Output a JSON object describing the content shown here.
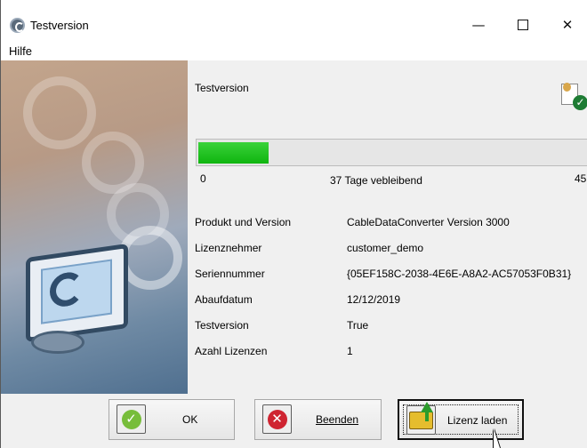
{
  "window": {
    "title": "Testversion"
  },
  "menu": {
    "hilfe": "Hilfe"
  },
  "content": {
    "heading": "Testversion"
  },
  "progress": {
    "start": "0",
    "end": "45",
    "remaining_label": "37  Tage vebleibend",
    "fill_fraction": 0.18
  },
  "info": [
    {
      "label": "Produkt und Version",
      "value": "CableDataConverter  Version 3000"
    },
    {
      "label": "Lizenznehmer",
      "value": "customer_demo"
    },
    {
      "label": "Seriennummer",
      "value": "{05EF158C-2038-4E6E-A8A2-AC57053F0B31}"
    },
    {
      "label": "Abaufdatum",
      "value": "12/12/2019"
    },
    {
      "label": "Testversion",
      "value": "True"
    },
    {
      "label": "Azahl Lizenzen",
      "value": "1"
    }
  ],
  "buttons": {
    "ok": "OK",
    "quit": "Beenden",
    "load_license": "Lizenz laden"
  },
  "icons": {
    "app": "copyright-icon",
    "certificate": "certificate-check-icon",
    "ok": "green-check-icon",
    "quit": "red-x-icon",
    "license": "folder-upload-icon"
  },
  "colors": {
    "progress": "#20c320",
    "ok": "#77bd3b",
    "quit": "#cf2431"
  }
}
